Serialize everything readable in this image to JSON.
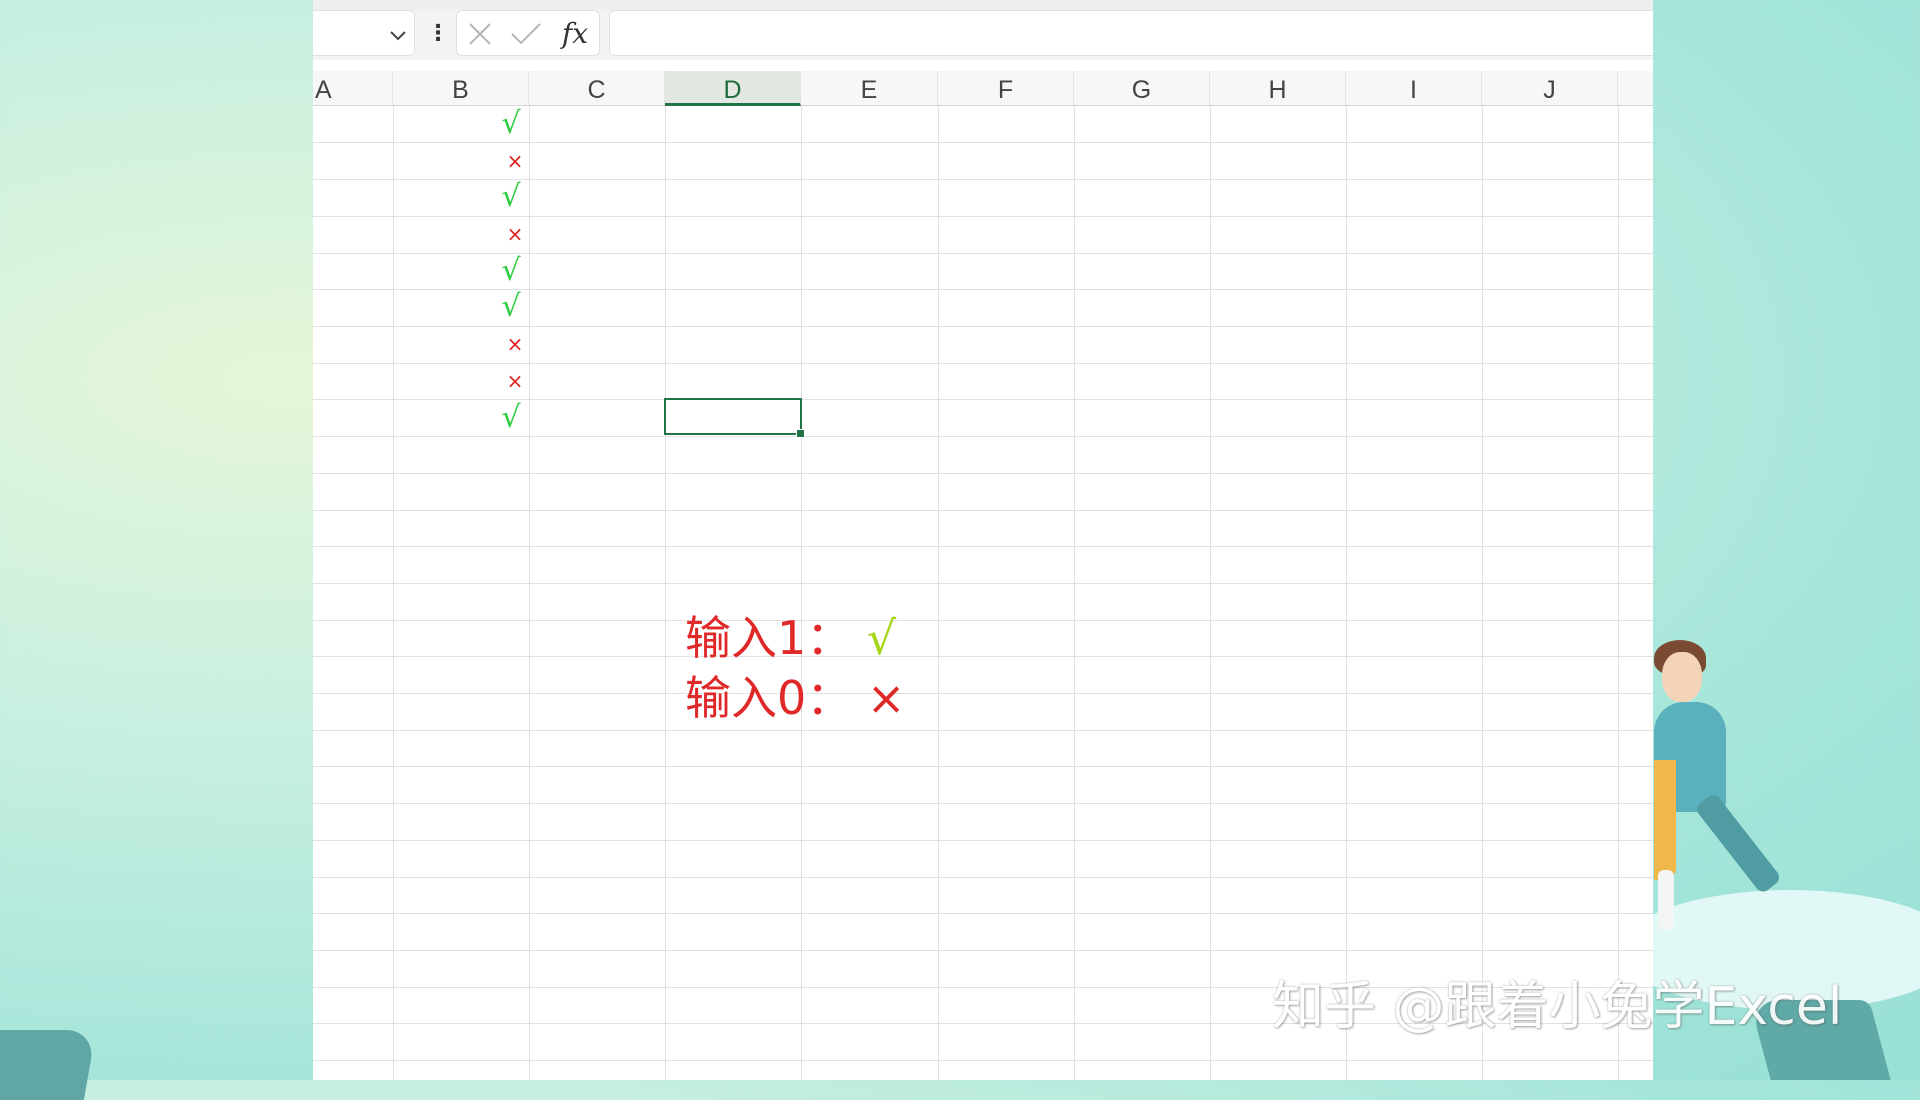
{
  "formula_bar": {
    "name_box_value": "",
    "formula_value": "",
    "fx_label": "fx"
  },
  "columns": [
    "A",
    "B",
    "C",
    "D",
    "E",
    "F",
    "G",
    "H",
    "I",
    "J"
  ],
  "active_column": "D",
  "column_b_marks": [
    "√",
    "×",
    "√",
    "×",
    "√",
    "√",
    "×",
    "×",
    "√"
  ],
  "note": {
    "line1_text": "输入1：",
    "line1_symbol": "√",
    "line2_text": "输入0：",
    "line2_symbol": "×"
  },
  "watermark": "知乎 @跟着小兔学Excel",
  "colors": {
    "accent_green": "#217346",
    "check_green": "#2ecc40",
    "cross_red": "#e02020",
    "note_red": "#e02828",
    "note_check": "#a6d61a"
  }
}
